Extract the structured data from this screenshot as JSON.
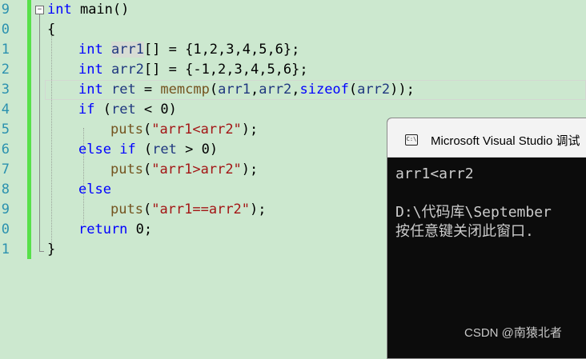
{
  "editor": {
    "line_numbers": [
      "9",
      "0",
      "1",
      "2",
      "3",
      "4",
      "5",
      "6",
      "7",
      "8",
      "9",
      "0",
      "1"
    ],
    "fold_symbol": "−",
    "code": {
      "l1": {
        "kw": "int",
        "rest": " main()"
      },
      "l2": {
        "text": "{"
      },
      "l3": {
        "kw": "int",
        "var": "arr1",
        "rest": "[] = {1,2,3,4,5,6};"
      },
      "l4": {
        "kw": "int",
        "var": "arr2",
        "rest": "[] = {-1,2,3,4,5,6};"
      },
      "l5": {
        "kw": "int",
        "var": "ret",
        "eq": " = ",
        "fn": "memcmp",
        "p1": "(",
        "a1": "arr1",
        "c1": ",",
        "a2": "arr2",
        "c2": ",",
        "kw2": "sizeof",
        "p2": "(",
        "a3": "arr2",
        "end": "));"
      },
      "l6": {
        "kw": "if",
        "p": " (",
        "var": "ret",
        "rest": " < 0)"
      },
      "l7": {
        "fn": "puts",
        "p": "(",
        "str": "\"arr1<arr2\"",
        "end": ");"
      },
      "l8": {
        "kw": "else",
        "kw2": "if",
        "p": " (",
        "var": "ret",
        "rest": " > 0)"
      },
      "l9": {
        "fn": "puts",
        "p": "(",
        "str": "\"arr1>arr2\"",
        "end": ");"
      },
      "l10": {
        "kw": "else"
      },
      "l11": {
        "fn": "puts",
        "p": "(",
        "str": "\"arr1==arr2\"",
        "end": ");"
      },
      "l12": {
        "kw": "return",
        "rest": " 0;"
      },
      "l13": {
        "text": "}"
      }
    }
  },
  "console": {
    "icon_label": "C:\\",
    "title": "Microsoft Visual Studio 调试",
    "output": [
      "arr1<arr2",
      "",
      "D:\\代码库\\September",
      "按任意键关闭此窗口."
    ]
  },
  "watermark": "CSDN @南猿北者",
  "colors": {
    "background": "#cce8cf",
    "keyword": "#0000ff",
    "function": "#74531f",
    "variable": "#1f377f",
    "string": "#a31515",
    "line_number": "#2b91af",
    "change_bar": "#57e04a",
    "console_bg": "#0c0c0c"
  }
}
